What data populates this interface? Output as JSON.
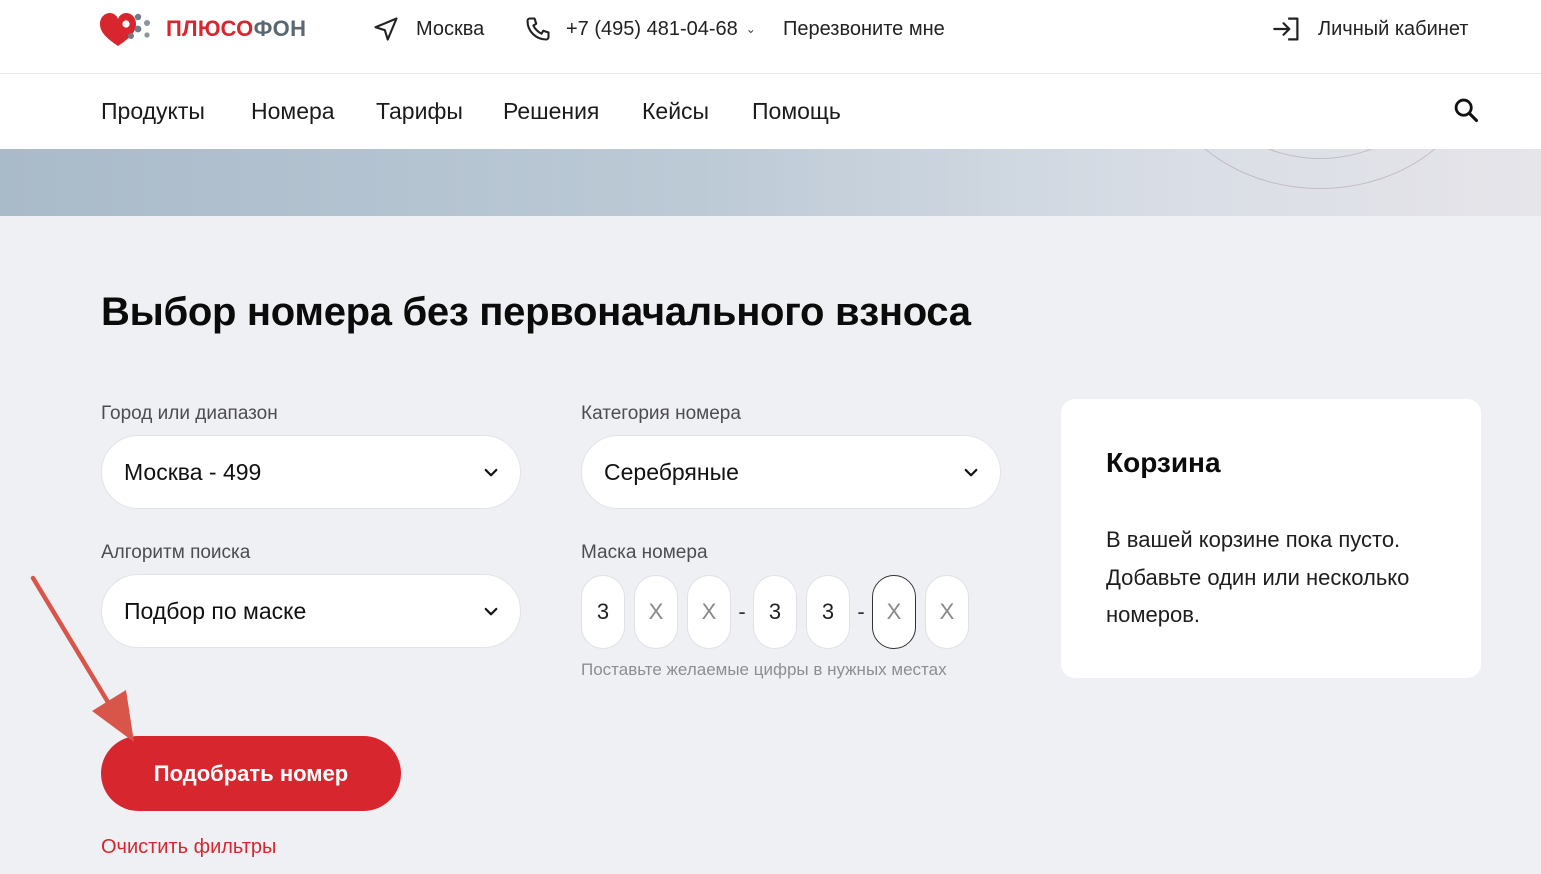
{
  "header": {
    "logo": {
      "part1": "ПЛЮСО",
      "part2": "ФОН",
      "brand_color": "#d7262e",
      "secondary_color": "#5b6773"
    },
    "city": "Москва",
    "phone": "+7 (495) 481-04-68",
    "callback": "Перезвоните мне",
    "cabinet": "Личный кабинет"
  },
  "nav": {
    "items": [
      "Продукты",
      "Номера",
      "Тарифы",
      "Решения",
      "Кейсы",
      "Помощь"
    ]
  },
  "page": {
    "title": "Выбор номера без первоначального взноса"
  },
  "filters": {
    "city": {
      "label": "Город или диапазон",
      "value": "Москва - 499"
    },
    "category": {
      "label": "Категория номера",
      "value": "Серебряные"
    },
    "algorithm": {
      "label": "Алгоритм поиска",
      "value": "Подбор по маске"
    },
    "mask": {
      "label": "Маска номера",
      "cells": [
        "3",
        "X",
        "X",
        "3",
        "3",
        "X",
        "X"
      ],
      "separator": "-",
      "hint": "Поставьте желаемые цифры в нужных местах"
    }
  },
  "cart": {
    "title": "Корзина",
    "text": "В вашей корзине пока пусто. Добавьте один или несколько номеров."
  },
  "actions": {
    "submit": "Подобрать номер",
    "clear": "Очистить фильтры"
  },
  "colors": {
    "accent": "#d7262e",
    "background": "#eff0f4",
    "annotation_arrow": "#d8554a"
  }
}
